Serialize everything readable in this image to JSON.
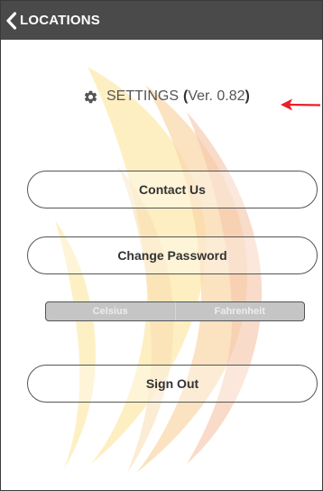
{
  "nav": {
    "back_label": "LOCATIONS",
    "back_icon": "chevron-left-icon",
    "background_color": "#4a4a4a"
  },
  "settings": {
    "icon": "gear-icon",
    "title": "SETTINGS",
    "paren_open": "(",
    "version": "Ver. 0.82",
    "paren_close": ")"
  },
  "annotation": {
    "icon": "red-arrow-icon",
    "color": "#e8202a"
  },
  "buttons": {
    "contact_label": "Contact Us",
    "password_label": "Change Password",
    "signout_label": "Sign Out"
  },
  "temperature_toggle": {
    "options": [
      "Celsius",
      "Fahrenheit"
    ]
  },
  "background_watermark": {
    "icon": "flame-icon",
    "colors": [
      "#fde7a6",
      "#f7cfa0",
      "#f6c2a8"
    ]
  }
}
